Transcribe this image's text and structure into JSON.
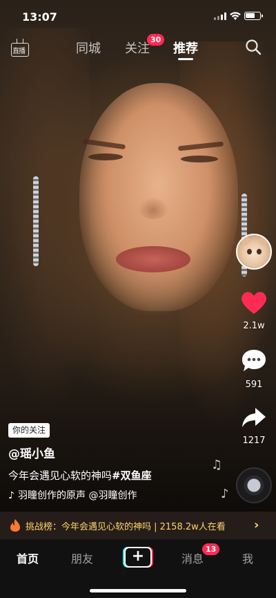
{
  "status_bar": {
    "time": "13:07"
  },
  "top_nav": {
    "live_icon_text": "直播",
    "tabs": [
      {
        "label": "同城",
        "active": false
      },
      {
        "label": "关注",
        "active": false,
        "badge": "30"
      },
      {
        "label": "推荐",
        "active": true
      }
    ],
    "search_icon": "search-icon"
  },
  "right_rail": {
    "avatar_icon": "cat-avatar",
    "like_count": "2.1w",
    "comment_count": "591",
    "share_count": "1217",
    "like_color": "#fe2c55"
  },
  "caption": {
    "follow_tag": "你的关注",
    "username": "@瑶小鱼",
    "text": "今年会遇见心软的神吗",
    "hashtag": "#双鱼座",
    "sound": "羽瞳创作的原声    @羽瞳创作"
  },
  "challenge_bar": {
    "text": "挑战榜：今年会遇见心软的神吗 | 2158.2w人在看",
    "arrow": "›",
    "color": "#ffd36a"
  },
  "bottom_tabs": {
    "home": "首页",
    "friends": "朋友",
    "plus": "+",
    "messages": "消息",
    "messages_badge": "13",
    "me": "我"
  }
}
